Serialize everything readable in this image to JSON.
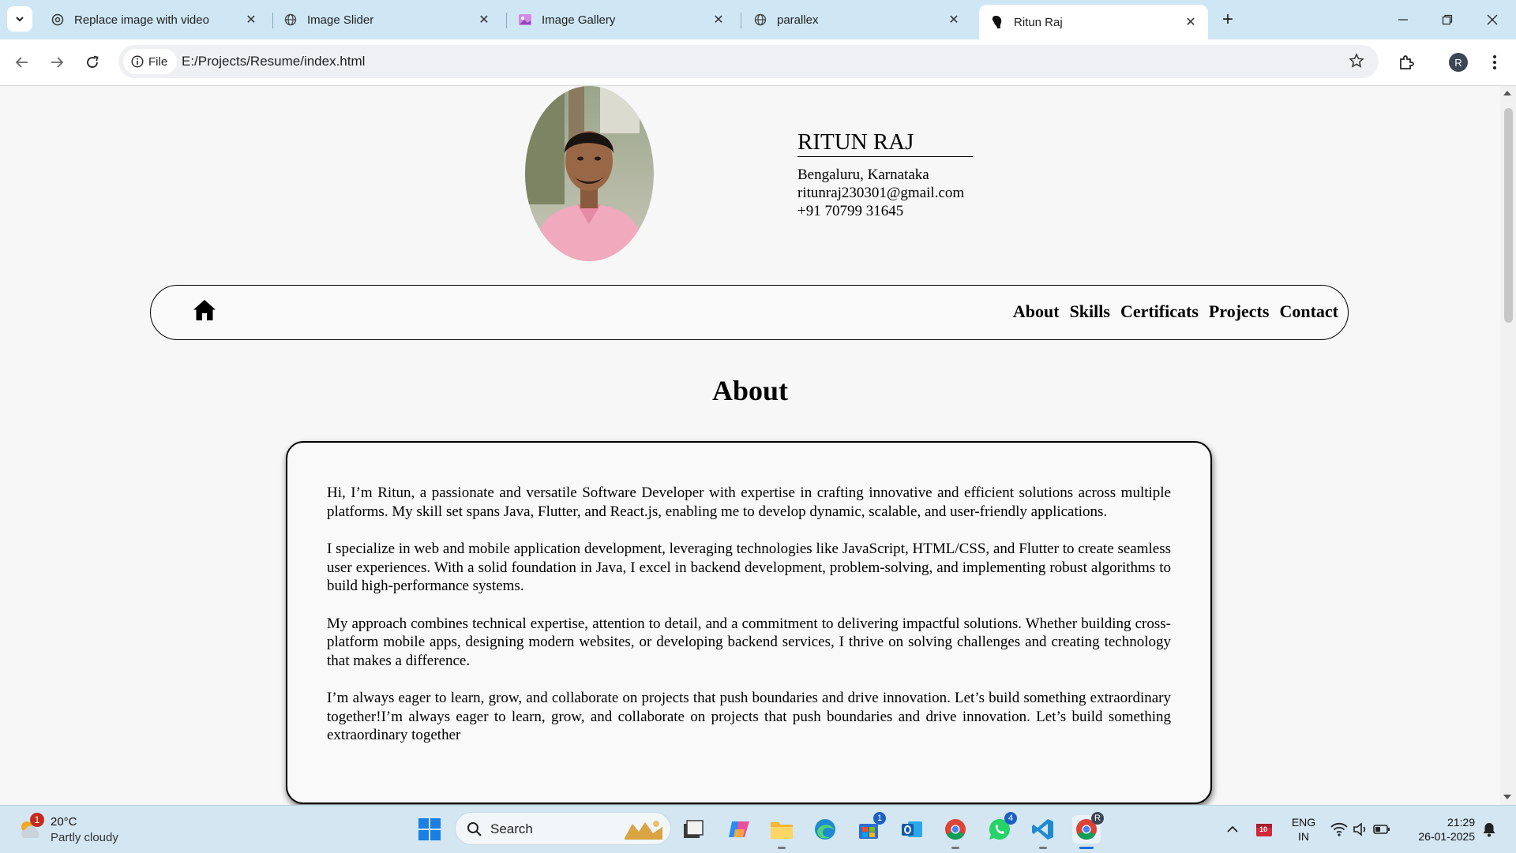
{
  "browser": {
    "tabs": [
      {
        "label": "Replace image with video",
        "icon": "openai-icon",
        "active": false
      },
      {
        "label": "Image Slider",
        "icon": "globe-icon",
        "active": false
      },
      {
        "label": "Image Gallery",
        "icon": "gallery-icon",
        "active": false
      },
      {
        "label": "parallex",
        "icon": "globe-icon",
        "active": false
      },
      {
        "label": "Ritun Raj",
        "icon": "tab-favicon-icon",
        "active": true
      }
    ],
    "omnibox": {
      "chip_label": "File",
      "url": "E:/Projects/Resume/index.html"
    },
    "profile_initial": "R"
  },
  "page": {
    "name": "RITUN RAJ",
    "location": "Bengaluru, Karnataka",
    "email": "ritunraj230301@gmail.com",
    "phone": "+91 70799 31645",
    "nav": {
      "home_icon": "home-icon",
      "links": [
        "About",
        "Skills",
        "Certificats",
        "Projects",
        "Contact"
      ]
    },
    "section_title": "About",
    "about_paragraphs": [
      "Hi, I’m Ritun, a passionate and versatile Software Developer with expertise in crafting innovative and efficient solutions across multiple platforms. My skill set spans Java, Flutter, and React.js, enabling me to develop dynamic, scalable, and user-friendly applications.",
      "I specialize in web and mobile application development, leveraging technologies like JavaScript, HTML/CSS, and Flutter to create seamless user experiences. With a solid foundation in Java, I excel in backend development, problem-solving, and implementing robust algorithms to build high-performance systems.",
      "My approach combines technical expertise, attention to detail, and a commitment to delivering impactful solutions. Whether building cross-platform mobile apps, designing modern websites, or developing backend services, I thrive on solving challenges and creating technology that makes a difference.",
      "I’m always eager to learn, grow, and collaborate on projects that push boundaries and drive innovation. Let’s build something extraordinary together!I’m always eager to learn, grow, and collaborate on projects that push boundaries and drive innovation. Let’s build something extraordinary together"
    ]
  },
  "taskbar": {
    "weather": {
      "temp": "20°C",
      "desc": "Partly cloudy",
      "badge": "1"
    },
    "search_label": "Search",
    "badges": {
      "store": "1",
      "whatsapp": "4",
      "chrome_profile": "R"
    },
    "tray": {
      "lang_top": "ENG",
      "lang_bottom": "IN",
      "time": "21:29",
      "date": "26-01-2025",
      "calendar_badge": "10"
    }
  },
  "colors": {
    "tabbar": "#cfe7f5",
    "taskbar": "#d3e6f2",
    "page_bg": "#f7f7f7",
    "accent": "#1a6fd6"
  }
}
